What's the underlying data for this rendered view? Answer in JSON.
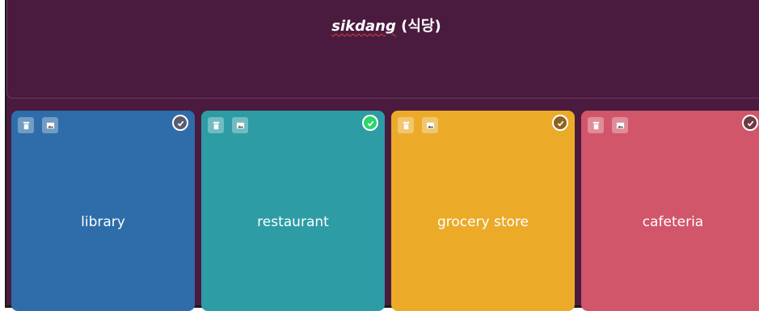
{
  "question": {
    "word": "sikdang",
    "hangul": "(식당)"
  },
  "cards": [
    {
      "label": "library",
      "color": "#2e6da9",
      "checked": false,
      "check_fill": "#5b5b6e"
    },
    {
      "label": "restaurant",
      "color": "#2d9ca5",
      "checked": true,
      "check_fill": "#2fd46a"
    },
    {
      "label": "grocery store",
      "color": "#ebab29",
      "checked": false,
      "check_fill": "#8b6420"
    },
    {
      "label": "cafeteria",
      "color": "#d1566a",
      "checked": false,
      "check_fill": "#6e3a45"
    }
  ],
  "icons": {
    "delete": "trash-icon",
    "image": "image-icon",
    "correct": "check-circle-icon"
  }
}
